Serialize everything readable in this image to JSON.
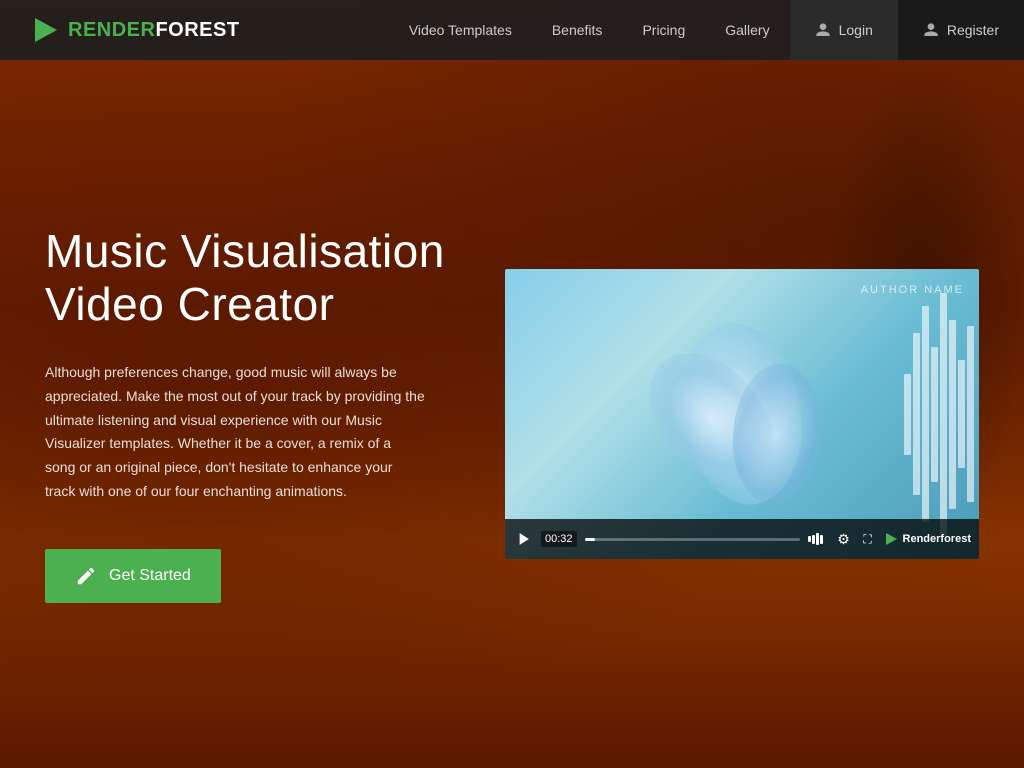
{
  "nav": {
    "logo_render": "RENDER",
    "logo_forest": "FOREST",
    "links": [
      {
        "label": "Video Templates",
        "id": "video-templates"
      },
      {
        "label": "Benefits",
        "id": "benefits"
      },
      {
        "label": "Pricing",
        "id": "pricing"
      },
      {
        "label": "Gallery",
        "id": "gallery"
      }
    ],
    "login_label": "Login",
    "register_label": "Register"
  },
  "hero": {
    "title": "Music Visualisation Video Creator",
    "description": "Although preferences change, good music will always be appreciated. Make the most out of your track by providing the ultimate listening and visual experience with our Music Visualizer templates. Whether it be a cover, a remix of a song or an original piece, don't hesitate to enhance your track with one of our four enchanting animations.",
    "cta_label": "Get Started"
  },
  "video": {
    "author_label": "AUTHOR NAME",
    "time": "00:32",
    "brand": "Renderforest"
  }
}
